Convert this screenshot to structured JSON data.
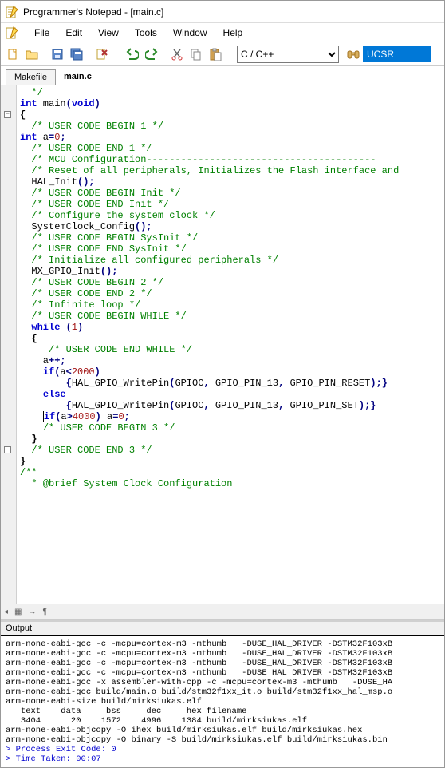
{
  "window": {
    "title": "Programmer's Notepad - [main.c]"
  },
  "menus": [
    "File",
    "Edit",
    "View",
    "Tools",
    "Window",
    "Help"
  ],
  "language_select": {
    "value": "C / C++"
  },
  "search": {
    "value": "UCSR"
  },
  "tabs": [
    {
      "label": "Makefile",
      "active": false
    },
    {
      "label": "main.c",
      "active": true
    }
  ],
  "code_lines": [
    {
      "segs": [
        {
          "t": "cm",
          "v": "  */"
        }
      ]
    },
    {
      "segs": [
        {
          "t": "kw",
          "v": "int"
        },
        {
          "t": "",
          "v": " main"
        },
        {
          "t": "op",
          "v": "("
        },
        {
          "t": "kw",
          "v": "void"
        },
        {
          "t": "op",
          "v": ")"
        }
      ]
    },
    {
      "segs": [
        {
          "t": "br",
          "v": "{"
        }
      ],
      "fold": "-"
    },
    {
      "segs": [
        {
          "t": "",
          "v": "  "
        },
        {
          "t": "cm",
          "v": "/* USER CODE BEGIN 1 */"
        }
      ]
    },
    {
      "segs": [
        {
          "t": "kw",
          "v": "int"
        },
        {
          "t": "",
          "v": " a"
        },
        {
          "t": "op",
          "v": "="
        },
        {
          "t": "num",
          "v": "0"
        },
        {
          "t": "op",
          "v": ";"
        }
      ]
    },
    {
      "segs": [
        {
          "t": "",
          "v": "  "
        },
        {
          "t": "cm",
          "v": "/* USER CODE END 1 */"
        }
      ]
    },
    {
      "segs": [
        {
          "t": "",
          "v": ""
        }
      ]
    },
    {
      "segs": [
        {
          "t": "",
          "v": "  "
        },
        {
          "t": "cm",
          "v": "/* MCU Configuration----------------------------------------"
        }
      ]
    },
    {
      "segs": [
        {
          "t": "",
          "v": ""
        }
      ]
    },
    {
      "segs": [
        {
          "t": "",
          "v": "  "
        },
        {
          "t": "cm",
          "v": "/* Reset of all peripherals, Initializes the Flash interface and"
        }
      ]
    },
    {
      "segs": [
        {
          "t": "",
          "v": "  HAL_Init"
        },
        {
          "t": "op",
          "v": "();"
        }
      ]
    },
    {
      "segs": [
        {
          "t": "",
          "v": ""
        }
      ]
    },
    {
      "segs": [
        {
          "t": "",
          "v": "  "
        },
        {
          "t": "cm",
          "v": "/* USER CODE BEGIN Init */"
        }
      ]
    },
    {
      "segs": [
        {
          "t": "",
          "v": ""
        }
      ]
    },
    {
      "segs": [
        {
          "t": "",
          "v": "  "
        },
        {
          "t": "cm",
          "v": "/* USER CODE END Init */"
        }
      ]
    },
    {
      "segs": [
        {
          "t": "",
          "v": ""
        }
      ]
    },
    {
      "segs": [
        {
          "t": "",
          "v": "  "
        },
        {
          "t": "cm",
          "v": "/* Configure the system clock */"
        }
      ]
    },
    {
      "segs": [
        {
          "t": "",
          "v": "  SystemClock_Config"
        },
        {
          "t": "op",
          "v": "();"
        }
      ]
    },
    {
      "segs": [
        {
          "t": "",
          "v": ""
        }
      ]
    },
    {
      "segs": [
        {
          "t": "",
          "v": "  "
        },
        {
          "t": "cm",
          "v": "/* USER CODE BEGIN SysInit */"
        }
      ]
    },
    {
      "segs": [
        {
          "t": "",
          "v": ""
        }
      ]
    },
    {
      "segs": [
        {
          "t": "",
          "v": "  "
        },
        {
          "t": "cm",
          "v": "/* USER CODE END SysInit */"
        }
      ]
    },
    {
      "segs": [
        {
          "t": "",
          "v": ""
        }
      ]
    },
    {
      "segs": [
        {
          "t": "",
          "v": "  "
        },
        {
          "t": "cm",
          "v": "/* Initialize all configured peripherals */"
        }
      ]
    },
    {
      "segs": [
        {
          "t": "",
          "v": "  MX_GPIO_Init"
        },
        {
          "t": "op",
          "v": "();"
        }
      ]
    },
    {
      "segs": [
        {
          "t": "",
          "v": "  "
        },
        {
          "t": "cm",
          "v": "/* USER CODE BEGIN 2 */"
        }
      ]
    },
    {
      "segs": [
        {
          "t": "",
          "v": ""
        }
      ]
    },
    {
      "segs": [
        {
          "t": "",
          "v": "  "
        },
        {
          "t": "cm",
          "v": "/* USER CODE END 2 */"
        }
      ]
    },
    {
      "segs": [
        {
          "t": "",
          "v": ""
        }
      ]
    },
    {
      "segs": [
        {
          "t": "",
          "v": "  "
        },
        {
          "t": "cm",
          "v": "/* Infinite loop */"
        }
      ]
    },
    {
      "segs": [
        {
          "t": "",
          "v": "  "
        },
        {
          "t": "cm",
          "v": "/* USER CODE BEGIN WHILE */"
        }
      ]
    },
    {
      "segs": [
        {
          "t": "",
          "v": "  "
        },
        {
          "t": "kw",
          "v": "while"
        },
        {
          "t": "",
          "v": " "
        },
        {
          "t": "op",
          "v": "("
        },
        {
          "t": "num",
          "v": "1"
        },
        {
          "t": "op",
          "v": ")"
        }
      ]
    },
    {
      "segs": [
        {
          "t": "",
          "v": "  "
        },
        {
          "t": "br",
          "v": "{"
        }
      ],
      "fold": "-"
    },
    {
      "segs": [
        {
          "t": "",
          "v": "     "
        },
        {
          "t": "cm",
          "v": "/* USER CODE END WHILE */"
        }
      ]
    },
    {
      "segs": [
        {
          "t": "",
          "v": "    a"
        },
        {
          "t": "op",
          "v": "++;"
        }
      ]
    },
    {
      "segs": [
        {
          "t": "",
          "v": "    "
        },
        {
          "t": "kw",
          "v": "if"
        },
        {
          "t": "op",
          "v": "("
        },
        {
          "t": "",
          "v": "a"
        },
        {
          "t": "op",
          "v": "<"
        },
        {
          "t": "num",
          "v": "2000"
        },
        {
          "t": "op",
          "v": ")"
        }
      ]
    },
    {
      "segs": [
        {
          "t": "",
          "v": "        "
        },
        {
          "t": "op",
          "v": "{"
        },
        {
          "t": "",
          "v": "HAL_GPIO_WritePin"
        },
        {
          "t": "op",
          "v": "("
        },
        {
          "t": "",
          "v": "GPIOC"
        },
        {
          "t": "op",
          "v": ","
        },
        {
          "t": "",
          "v": " GPIO_PIN_13"
        },
        {
          "t": "op",
          "v": ","
        },
        {
          "t": "",
          "v": " GPIO_PIN_RESET"
        },
        {
          "t": "op",
          "v": ");}"
        }
      ]
    },
    {
      "segs": [
        {
          "t": "",
          "v": "    "
        },
        {
          "t": "kw",
          "v": "else"
        }
      ]
    },
    {
      "segs": [
        {
          "t": "",
          "v": "        "
        },
        {
          "t": "op",
          "v": "{"
        },
        {
          "t": "",
          "v": "HAL_GPIO_WritePin"
        },
        {
          "t": "op",
          "v": "("
        },
        {
          "t": "",
          "v": "GPIOC"
        },
        {
          "t": "op",
          "v": ","
        },
        {
          "t": "",
          "v": " GPIO_PIN_13"
        },
        {
          "t": "op",
          "v": ","
        },
        {
          "t": "",
          "v": " GPIO_PIN_SET"
        },
        {
          "t": "op",
          "v": ");}"
        }
      ]
    },
    {
      "segs": [
        {
          "t": "",
          "v": ""
        }
      ]
    },
    {
      "segs": [
        {
          "t": "",
          "v": "    "
        },
        {
          "t": "cursor",
          "v": ""
        },
        {
          "t": "kw",
          "v": "if"
        },
        {
          "t": "op",
          "v": "("
        },
        {
          "t": "",
          "v": "a"
        },
        {
          "t": "op",
          "v": ">"
        },
        {
          "t": "num",
          "v": "4000"
        },
        {
          "t": "op",
          "v": ")"
        },
        {
          "t": "",
          "v": " a"
        },
        {
          "t": "op",
          "v": "="
        },
        {
          "t": "num",
          "v": "0"
        },
        {
          "t": "op",
          "v": ";"
        }
      ]
    },
    {
      "segs": [
        {
          "t": "",
          "v": "    "
        },
        {
          "t": "cm",
          "v": "/* USER CODE BEGIN 3 */"
        }
      ]
    },
    {
      "segs": [
        {
          "t": "",
          "v": "  "
        },
        {
          "t": "br",
          "v": "}"
        }
      ]
    },
    {
      "segs": [
        {
          "t": "",
          "v": "  "
        },
        {
          "t": "cm",
          "v": "/* USER CODE END 3 */"
        }
      ]
    },
    {
      "segs": [
        {
          "t": "",
          "v": ""
        }
      ]
    },
    {
      "segs": [
        {
          "t": "br",
          "v": "}"
        }
      ]
    },
    {
      "segs": [
        {
          "t": "",
          "v": ""
        }
      ]
    },
    {
      "segs": [
        {
          "t": "cm",
          "v": "/**"
        }
      ],
      "fold": "-"
    },
    {
      "segs": [
        {
          "t": "cm",
          "v": "  * @brief System Clock Configuration"
        }
      ]
    }
  ],
  "output_panel": {
    "header": "Output",
    "lines": [
      "arm-none-eabi-gcc -c -mcpu=cortex-m3 -mthumb   -DUSE_HAL_DRIVER -DSTM32F103xB",
      "arm-none-eabi-gcc -c -mcpu=cortex-m3 -mthumb   -DUSE_HAL_DRIVER -DSTM32F103xB",
      "arm-none-eabi-gcc -c -mcpu=cortex-m3 -mthumb   -DUSE_HAL_DRIVER -DSTM32F103xB",
      "arm-none-eabi-gcc -c -mcpu=cortex-m3 -mthumb   -DUSE_HAL_DRIVER -DSTM32F103xB",
      "arm-none-eabi-gcc -x assembler-with-cpp -c -mcpu=cortex-m3 -mthumb   -DUSE_HA",
      "arm-none-eabi-gcc build/main.o build/stm32f1xx_it.o build/stm32f1xx_hal_msp.o",
      "arm-none-eabi-size build/mirksiukas.elf",
      "   text    data     bss     dec     hex filename",
      "   3404      20    1572    4996    1384 build/mirksiukas.elf",
      "arm-none-eabi-objcopy -O ihex build/mirksiukas.elf build/mirksiukas.hex",
      "arm-none-eabi-objcopy -O binary -S build/mirksiukas.elf build/mirksiukas.bin",
      "",
      "> Process Exit Code: 0",
      "> Time Taken: 00:07"
    ],
    "status_line_indices": [
      12,
      13
    ]
  }
}
